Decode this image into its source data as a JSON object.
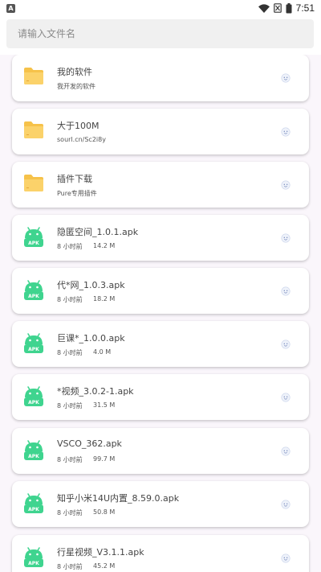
{
  "status_bar": {
    "app_badge": "A",
    "time": "7:51",
    "icons": [
      "wifi-icon",
      "cellular-off-icon",
      "battery-icon"
    ]
  },
  "search": {
    "placeholder": "请输入文件名",
    "value": ""
  },
  "folders": [
    {
      "title": "我的软件",
      "subtitle": "我开发的软件",
      "icon": "folder-icon"
    },
    {
      "title": "大于100M",
      "subtitle": "sourl.cn/Sc2i8y",
      "icon": "folder-icon"
    },
    {
      "title": "插件下载",
      "subtitle": "Pure专用插件",
      "icon": "folder-icon"
    }
  ],
  "files": [
    {
      "title": "隐匿空间_1.0.1.apk",
      "time": "8 小时前",
      "size": "14.2 M"
    },
    {
      "title": "代*网_1.0.3.apk",
      "time": "8 小时前",
      "size": "18.2 M"
    },
    {
      "title": "巨课*_1.0.0.apk",
      "time": "8 小时前",
      "size": "4.0 M"
    },
    {
      "title": "*视频_3.0.2-1.apk",
      "time": "8 小时前",
      "size": "31.5 M"
    },
    {
      "title": "VSCO_362.apk",
      "time": "8 小时前",
      "size": "99.7 M"
    },
    {
      "title": "知乎小米14U内置_8.59.0.apk",
      "time": "8 小时前",
      "size": "50.8 M"
    },
    {
      "title": "行星视频_V3.1.1.apk",
      "time": "8 小时前",
      "size": "45.2 M"
    }
  ],
  "apk_badge": "APK",
  "colors": {
    "folder": "#f6c24a",
    "apk": "#3fd48f",
    "background": "#faf6fb",
    "card": "#ffffff"
  }
}
